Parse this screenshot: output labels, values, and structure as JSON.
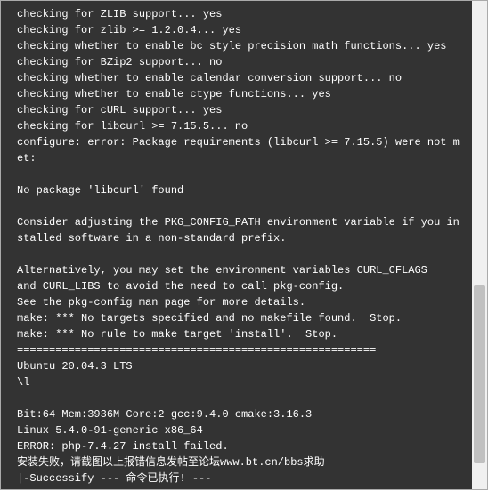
{
  "terminal": {
    "lines": [
      "checking for ZLIB support... yes",
      "checking for zlib >= 1.2.0.4... yes",
      "checking whether to enable bc style precision math functions... yes",
      "checking for BZip2 support... no",
      "checking whether to enable calendar conversion support... no",
      "checking whether to enable ctype functions... yes",
      "checking for cURL support... yes",
      "checking for libcurl >= 7.15.5... no",
      "configure: error: Package requirements (libcurl >= 7.15.5) were not met:",
      "",
      "No package 'libcurl' found",
      "",
      "Consider adjusting the PKG_CONFIG_PATH environment variable if you installed software in a non-standard prefix.",
      "",
      "Alternatively, you may set the environment variables CURL_CFLAGS",
      "and CURL_LIBS to avoid the need to call pkg-config.",
      "See the pkg-config man page for more details.",
      "make: *** No targets specified and no makefile found.  Stop.",
      "make: *** No rule to make target 'install'.  Stop.",
      "========================================================",
      "Ubuntu 20.04.3 LTS",
      "\\l",
      "",
      "Bit:64 Mem:3936M Core:2 gcc:9.4.0 cmake:3.16.3",
      "Linux 5.4.0-91-generic x86_64",
      "ERROR: php-7.4.27 install failed.",
      "安装失败，请截图以上报错信息发帖至论坛www.bt.cn/bbs求助",
      "|-Successify --- 命令已执行! ---"
    ]
  }
}
